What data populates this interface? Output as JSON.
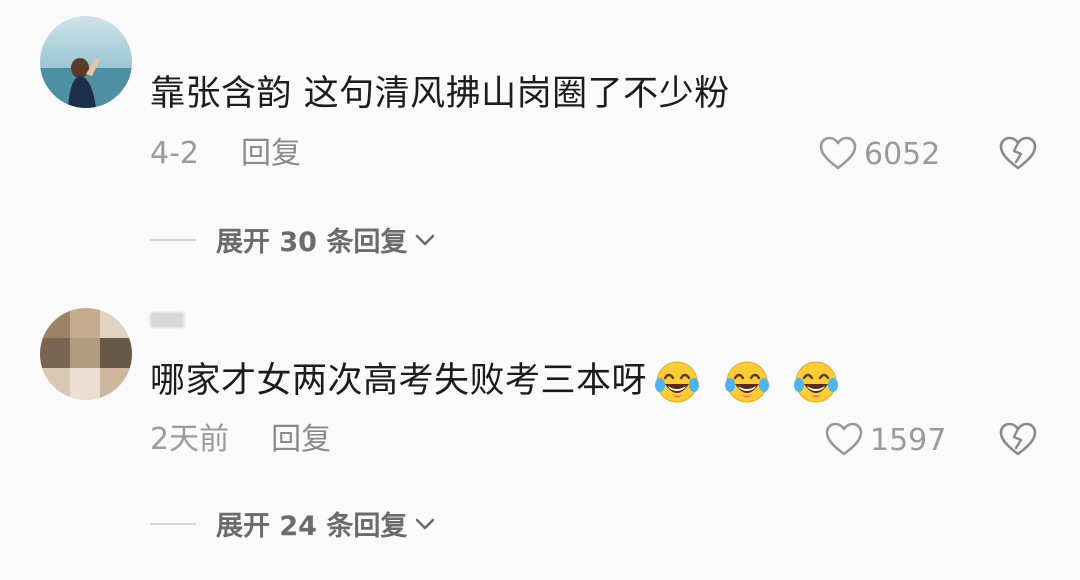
{
  "comments": [
    {
      "text": "靠张含韵 这句清风拂山岗圈了不少粉",
      "date": "4-2",
      "reply_label": "回复",
      "likes": "6052",
      "expand_label": "展开 30 条回复"
    },
    {
      "text": "哪家才女两次高考失败考三本呀",
      "emojis": [
        "laugh-crying-emoji",
        "laugh-crying-emoji",
        "laugh-crying-emoji"
      ],
      "date": "2天前",
      "reply_label": "回复",
      "likes": "1597",
      "expand_label": "展开 24 条回复"
    }
  ],
  "icons": {
    "like": "heart-outline-icon",
    "dislike": "broken-heart-icon",
    "expand": "chevron-down-icon"
  },
  "colors": {
    "background": "#fafafa",
    "text": "#1c1c1c",
    "meta": "#9a9a9a",
    "emoji_face": "#ffcc33"
  }
}
